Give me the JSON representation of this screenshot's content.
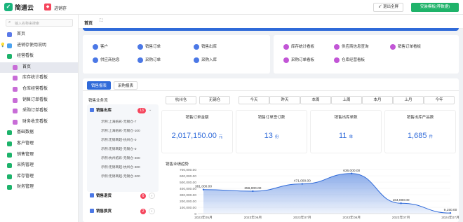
{
  "header": {
    "brand": "简道云",
    "app_icon_char": "◆",
    "app_name": "进销存",
    "exit_label": "↙ 退出全屏",
    "upgrade_label": "安装模板(荐数据)"
  },
  "sidebar": {
    "search_placeholder": "输入名称来搜索",
    "items": [
      {
        "label": "首页",
        "icon": "home-icon"
      },
      {
        "label": "进销存使用说明",
        "icon": "help-icon"
      },
      {
        "label": "经营看板",
        "icon": "folder-icon"
      },
      {
        "label": "首页",
        "icon": "board-icon",
        "sub": true,
        "active": true
      },
      {
        "label": "库存统计看板",
        "icon": "board-icon",
        "sub": true
      },
      {
        "label": "仓库经营看板",
        "icon": "board-icon",
        "sub": true
      },
      {
        "label": "销售订单看板",
        "icon": "board-icon",
        "sub": true
      },
      {
        "label": "采购订单看板",
        "icon": "board-icon",
        "sub": true
      },
      {
        "label": "财务收支看板",
        "icon": "board-icon",
        "sub": true
      },
      {
        "label": "基础数据",
        "icon": "folder-icon"
      },
      {
        "label": "客户管理",
        "icon": "folder-icon"
      },
      {
        "label": "销售管理",
        "icon": "folder-icon"
      },
      {
        "label": "采购管理",
        "icon": "folder-icon"
      },
      {
        "label": "库存管理",
        "icon": "folder-icon"
      },
      {
        "label": "财务管理",
        "icon": "folder-icon"
      }
    ]
  },
  "tabs": {
    "home": "首页",
    "expand_icon": "⛶"
  },
  "quick_left": [
    "客户",
    "销售订单",
    "销售出库",
    "供应商信息",
    "采购订单",
    "采购入库"
  ],
  "quick_right": [
    "库存统计看板",
    "供应商信息查询",
    "销售订单看板",
    "采购订单看板",
    "仓库经营看板"
  ],
  "report": {
    "tabs": [
      "销售报表",
      "采购报表"
    ],
    "side_title": "销售业务流",
    "sales_out": {
      "label": "销售出库",
      "badge": "13",
      "rows": [
        "示例:上海纸彩-无锡仓-7",
        "示例:上海纸彩-无锡仓-100",
        "示例:无锡商超-杭州仓-0",
        "示例:无锡商超-无锡仓-0",
        "示例:杭州纸彩-无锡仓-400",
        "示例:无锡商超-杭州仓-300",
        "示例:无锡商超-无锡仓-200"
      ]
    },
    "sales_return": {
      "label": "销售退货",
      "badge": "6"
    },
    "sales_exchange": {
      "label": "销售换货",
      "badge": "2"
    },
    "warehouses": [
      "杭州仓",
      "无锡仓"
    ],
    "periods": [
      "今天",
      "昨天",
      "本周",
      "上周",
      "本月",
      "上月",
      "今年"
    ],
    "stats": [
      {
        "title": "销售订单金额",
        "value": "2,017,150.00",
        "unit": "元"
      },
      {
        "title": "销售订单签订数",
        "value": "13",
        "unit": "份"
      },
      {
        "title": "销售出库单数",
        "value": "11",
        "unit": "单"
      },
      {
        "title": "销售出库产品数",
        "value": "1,685",
        "unit": "件"
      }
    ],
    "trend_title": "销售业绩趋势"
  },
  "chart_data": {
    "type": "area",
    "title": "销售业绩趋势",
    "x": [
      "2023年05月",
      "2023年06月",
      "2023年07月",
      "2023年08月",
      "2023年07月",
      "2024年07月"
    ],
    "values": [
      381000,
      356000,
      471000,
      636000,
      164000,
      9150
    ],
    "value_labels": [
      "381,000.00",
      "356,000.00",
      "471,000.00",
      "636,000.00",
      "164,000.00",
      "9,150.00"
    ],
    "yticks": [
      "700,000.00",
      "600,000.00",
      "500,000.00",
      "400,000.00",
      "300,000.00",
      "200,000.00",
      "100,000.00",
      "0"
    ],
    "ylim": [
      0,
      700000
    ],
    "color": "#2f6ad9"
  }
}
